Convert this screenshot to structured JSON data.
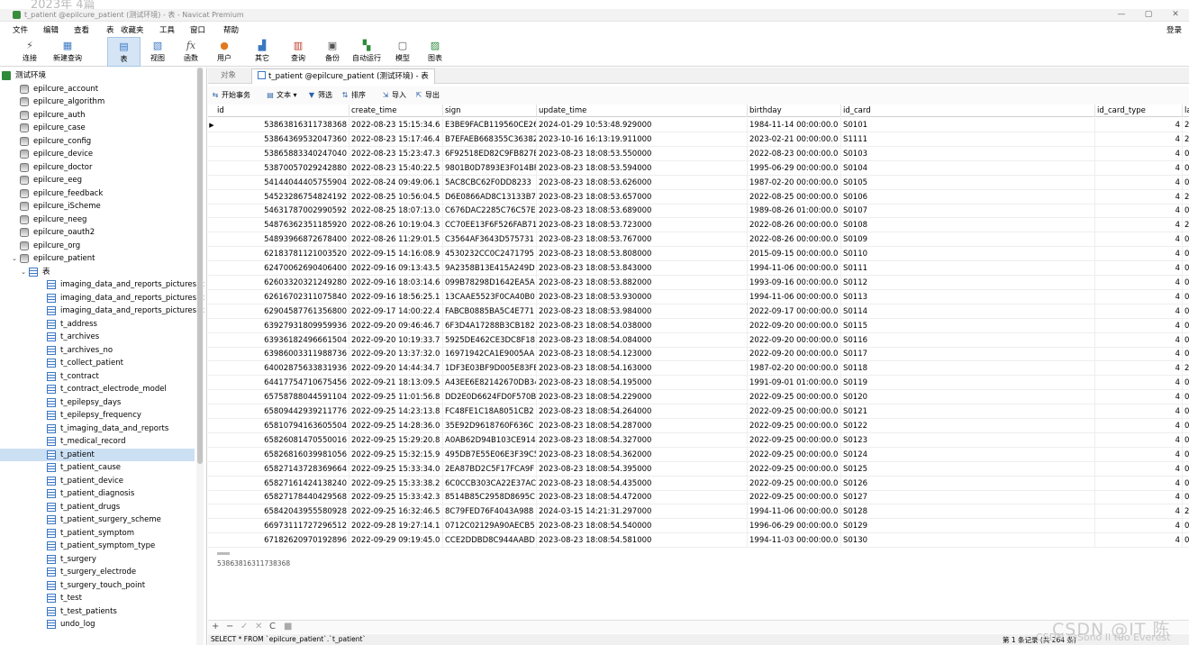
{
  "top_fragment": "2023年 4篇",
  "window": {
    "title": "t_patient @epilcure_patient (测试环境) - 表 - Navicat Premium",
    "controls": [
      "—",
      "▢",
      "✕"
    ]
  },
  "menu": {
    "items": [
      "文件",
      "编辑",
      "查看",
      "表",
      "收藏夹",
      "工具",
      "窗口",
      "帮助"
    ],
    "login": "登录"
  },
  "toolbar": {
    "items": [
      {
        "label": "连接",
        "icon": "plug-icon"
      },
      {
        "label": "新建查询",
        "icon": "new-query-icon"
      },
      {
        "label": "表",
        "icon": "table-icon"
      },
      {
        "label": "视图",
        "icon": "view-icon"
      },
      {
        "label": "函数",
        "icon": "function-icon"
      },
      {
        "label": "用户",
        "icon": "user-icon"
      },
      {
        "label": "其它",
        "icon": "other-icon"
      },
      {
        "label": "查询",
        "icon": "query-icon"
      },
      {
        "label": "备份",
        "icon": "backup-icon"
      },
      {
        "label": "自动运行",
        "icon": "automation-icon"
      },
      {
        "label": "模型",
        "icon": "model-icon"
      },
      {
        "label": "图表",
        "icon": "chart-icon"
      }
    ]
  },
  "sidebar": {
    "connection": "测试环境",
    "databases": [
      "epilcure_account",
      "epilcure_algorithm",
      "epilcure_auth",
      "epilcure_case",
      "epilcure_config",
      "epilcure_device",
      "epilcure_doctor",
      "epilcure_eeg",
      "epilcure_feedback",
      "epilcure_iScheme",
      "epilcure_neeg",
      "epilcure_oauth2",
      "epilcure_org"
    ],
    "open_db": "epilcure_patient",
    "tables_group": "表",
    "tables": [
      "imaging_data_and_reports_pictures_c",
      "imaging_data_and_reports_pictures_c",
      "imaging_data_and_reports_pictures_c",
      "t_address",
      "t_archives",
      "t_archives_no",
      "t_collect_patient",
      "t_contract",
      "t_contract_electrode_model",
      "t_epilepsy_days",
      "t_epilepsy_frequency",
      "t_imaging_data_and_reports",
      "t_medical_record",
      "t_patient",
      "t_patient_cause",
      "t_patient_device",
      "t_patient_diagnosis",
      "t_patient_drugs",
      "t_patient_surgery_scheme",
      "t_patient_symptom",
      "t_patient_symptom_type",
      "t_surgery",
      "t_surgery_electrode",
      "t_surgery_touch_point",
      "t_test",
      "t_test_patients",
      "undo_log"
    ],
    "selected_table": "t_patient"
  },
  "tabs": {
    "objects": "对象",
    "active": "t_patient @epilcure_patient (测试环境) - 表"
  },
  "grid_toolbar": [
    {
      "label": "开始事务",
      "icon": "transaction-icon"
    },
    {
      "label": "文本",
      "icon": "text-icon"
    },
    {
      "label": "筛选",
      "icon": "filter-icon"
    },
    {
      "label": "排序",
      "icon": "sort-icon"
    },
    {
      "label": "导入",
      "icon": "import-icon"
    },
    {
      "label": "导出",
      "icon": "export-icon"
    }
  ],
  "grid": {
    "columns": [
      "id",
      "create_time",
      "sign",
      "update_time",
      "birthday",
      "id_card",
      "id_card_type",
      "la"
    ],
    "rows": [
      [
        "53863816311738368",
        "2022-08-23 15:15:34.6",
        "E3BE9FACB119560CE26",
        "2024-01-29 10:53:48.929000",
        "1984-11-14 00:00:00.0",
        "S0101",
        "4",
        "2"
      ],
      [
        "53864369532047360",
        "2022-08-23 15:17:46.4",
        "B7EFAEB668355C36382",
        "2023-10-16 16:13:19.911000",
        "2023-02-21 00:00:00.0",
        "S1111",
        "4",
        "2"
      ],
      [
        "53865883340247040",
        "2022-08-23 15:23:47.3",
        "6F92518ED82C9FB827E",
        "2023-08-23 18:08:53.550000",
        "2022-08-23 00:00:00.0",
        "S0103",
        "4",
        "0"
      ],
      [
        "53870057029242880",
        "2022-08-23 15:40:22.5",
        "9801B0D7893E3F014BF",
        "2023-08-23 18:08:53.594000",
        "1995-06-29 00:00:00.0",
        "S0104",
        "4",
        "0"
      ],
      [
        "54144044405755904",
        "2022-08-24 09:49:06.1",
        "5AC8CBC62F0DD8233",
        "2023-08-23 18:08:53.626000",
        "1987-02-20 00:00:00.0",
        "S0105",
        "4",
        "0"
      ],
      [
        "54523286754824192",
        "2022-08-25 10:56:04.5",
        "D6E0866AD8C13133B7",
        "2023-08-23 18:08:53.657000",
        "2022-08-25 00:00:00.0",
        "S0106",
        "4",
        "2"
      ],
      [
        "54631787002990592",
        "2022-08-25 18:07:13.0",
        "C676DAC2285C76C57E",
        "2023-08-23 18:08:53.689000",
        "1989-08-26 01:00:00.0",
        "S0107",
        "4",
        "0"
      ],
      [
        "54876362351185920",
        "2022-08-26 10:19:04.3",
        "CC70EE13F6F526FAB71",
        "2023-08-23 18:08:53.723000",
        "2022-08-26 00:00:00.0",
        "S0108",
        "4",
        "2"
      ],
      [
        "54893966872678400",
        "2022-08-26 11:29:01.5",
        "C3564AF3643D575731",
        "2023-08-23 18:08:53.767000",
        "2022-08-26 00:00:00.0",
        "S0109",
        "4",
        "0"
      ],
      [
        "62183781121003520",
        "2022-09-15 14:16:08.9",
        "4530232CC0C2471795",
        "2023-08-23 18:08:53.808000",
        "2015-09-15 00:00:00.0",
        "S0110",
        "4",
        "0"
      ],
      [
        "62470062690406400",
        "2022-09-16 09:13:43.5",
        "9A2358B13E415A249D",
        "2023-08-23 18:08:53.843000",
        "1994-11-06 00:00:00.0",
        "S0111",
        "4",
        "0"
      ],
      [
        "62603320321249280",
        "2022-09-16 18:03:14.6",
        "099B78298D1642EA5A",
        "2023-08-23 18:08:53.882000",
        "1993-09-16 00:00:00.0",
        "S0112",
        "4",
        "0"
      ],
      [
        "62616702311075840",
        "2022-09-16 18:56:25.1",
        "13CAAE5523F0CA40B0",
        "2023-08-23 18:08:53.930000",
        "1994-11-06 00:00:00.0",
        "S0113",
        "4",
        "0"
      ],
      [
        "62904587761356800",
        "2022-09-17 14:00:22.4",
        "FABCB0885BA5C4E771",
        "2023-08-23 18:08:53.984000",
        "2022-09-17 00:00:00.0",
        "S0114",
        "4",
        "0"
      ],
      [
        "63927931809959936",
        "2022-09-20 09:46:46.7",
        "6F3D4A17288B3CB182",
        "2023-08-23 18:08:54.038000",
        "2022-09-20 00:00:00.0",
        "S0115",
        "4",
        "0"
      ],
      [
        "63936182496661504",
        "2022-09-20 10:19:33.7",
        "5925DE462CE3DC8F18",
        "2023-08-23 18:08:54.084000",
        "2022-09-20 00:00:00.0",
        "S0116",
        "4",
        "0"
      ],
      [
        "63986003311988736",
        "2022-09-20 13:37:32.0",
        "16971942CA1E9005AA",
        "2023-08-23 18:08:54.123000",
        "2022-09-20 00:00:00.0",
        "S0117",
        "4",
        "0"
      ],
      [
        "64002875633831936",
        "2022-09-20 14:44:34.7",
        "1DF3E03BF9D005E83FE",
        "2023-08-23 18:08:54.163000",
        "1987-02-20 00:00:00.0",
        "S0118",
        "4",
        "2"
      ],
      [
        "64417754710675456",
        "2022-09-21 18:13:09.5",
        "A43EE6E82142670DB34",
        "2023-08-23 18:08:54.195000",
        "1991-09-01 01:00:00.0",
        "S0119",
        "4",
        "0"
      ],
      [
        "65758788044591104",
        "2022-09-25 11:01:56.8",
        "DD2E0D6624FD0F570B",
        "2023-08-23 18:08:54.229000",
        "2022-09-25 00:00:00.0",
        "S0120",
        "4",
        "0"
      ],
      [
        "65809442939211776",
        "2022-09-25 14:23:13.8",
        "FC48FE1C18A8051CB2",
        "2023-08-23 18:08:54.264000",
        "2022-09-25 00:00:00.0",
        "S0121",
        "4",
        "0"
      ],
      [
        "65810794163605504",
        "2022-09-25 14:28:36.0",
        "35E92D9618760F636C",
        "2023-08-23 18:08:54.287000",
        "2022-09-25 00:00:00.0",
        "S0122",
        "4",
        "0"
      ],
      [
        "65826081470550016",
        "2022-09-25 15:29:20.8",
        "A0AB62D94B103CE914",
        "2023-08-23 18:08:54.327000",
        "2022-09-25 00:00:00.0",
        "S0123",
        "4",
        "0"
      ],
      [
        "65826816039981056",
        "2022-09-25 15:32:15.9",
        "495DB7E55E06E3F39C5",
        "2023-08-23 18:08:54.362000",
        "2022-09-25 00:00:00.0",
        "S0124",
        "4",
        "0"
      ],
      [
        "65827143728369664",
        "2022-09-25 15:33:34.0",
        "2EA87BD2C5F17FCA9F",
        "2023-08-23 18:08:54.395000",
        "2022-09-25 00:00:00.0",
        "S0125",
        "4",
        "0"
      ],
      [
        "65827161424138240",
        "2022-09-25 15:33:38.2",
        "6C0CCB303CA22E37AC",
        "2023-08-23 18:08:54.435000",
        "2022-09-25 00:00:00.0",
        "S0126",
        "4",
        "0"
      ],
      [
        "65827178440429568",
        "2022-09-25 15:33:42.3",
        "8514B85C2958D8695C",
        "2023-08-23 18:08:54.472000",
        "2022-09-25 00:00:00.0",
        "S0127",
        "4",
        "0"
      ],
      [
        "65842043955580928",
        "2022-09-25 16:32:46.5",
        "8C79FED76F4043A988",
        "2024-03-15 14:21:31.297000",
        "1994-11-06 00:00:00.0",
        "S0128",
        "4",
        "2"
      ],
      [
        "66973111727296512",
        "2022-09-28 19:27:14.1",
        "0712C02129A90AECB5",
        "2023-08-23 18:08:54.540000",
        "1996-06-29 00:00:00.0",
        "S0129",
        "4",
        "0"
      ],
      [
        "67182620970192896",
        "2022-09-29 09:19:45.0",
        "CCE2DDBD8C944AABD",
        "2023-08-23 18:08:54.581000",
        "1994-11-03 00:00:00.0",
        "S0130",
        "4",
        "0"
      ]
    ]
  },
  "field_value": "53863816311738368",
  "bottom_controls": [
    "+",
    "−",
    "✓",
    "✕",
    "C",
    "■"
  ],
  "status": {
    "sql": "SELECT * FROM `epilcure_patient`.`t_patient`",
    "records": "第 1 条记录 (共 264 条)"
  },
  "watermark": {
    "main": "CSDN @IT 陈",
    "sub": "CSDN @Sono Il tuo Everest"
  },
  "colors": {
    "selection": "#cce0f4",
    "accent": "#3b78c4",
    "connection": "#2e8b3a"
  }
}
